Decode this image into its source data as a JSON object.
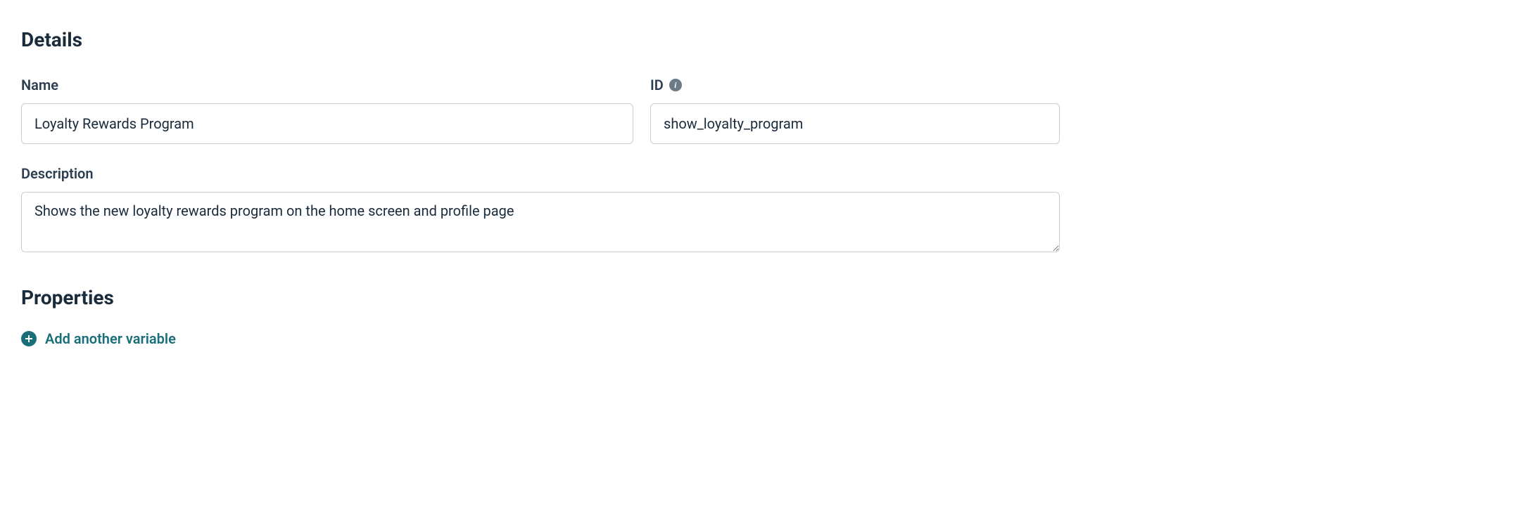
{
  "sections": {
    "details_heading": "Details",
    "properties_heading": "Properties"
  },
  "fields": {
    "name": {
      "label": "Name",
      "value": "Loyalty Rewards Program"
    },
    "id": {
      "label": "ID",
      "value": "show_loyalty_program"
    },
    "description": {
      "label": "Description",
      "value": "Shows the new loyalty rewards program on the home screen and profile page"
    }
  },
  "actions": {
    "add_variable": "Add another variable"
  }
}
